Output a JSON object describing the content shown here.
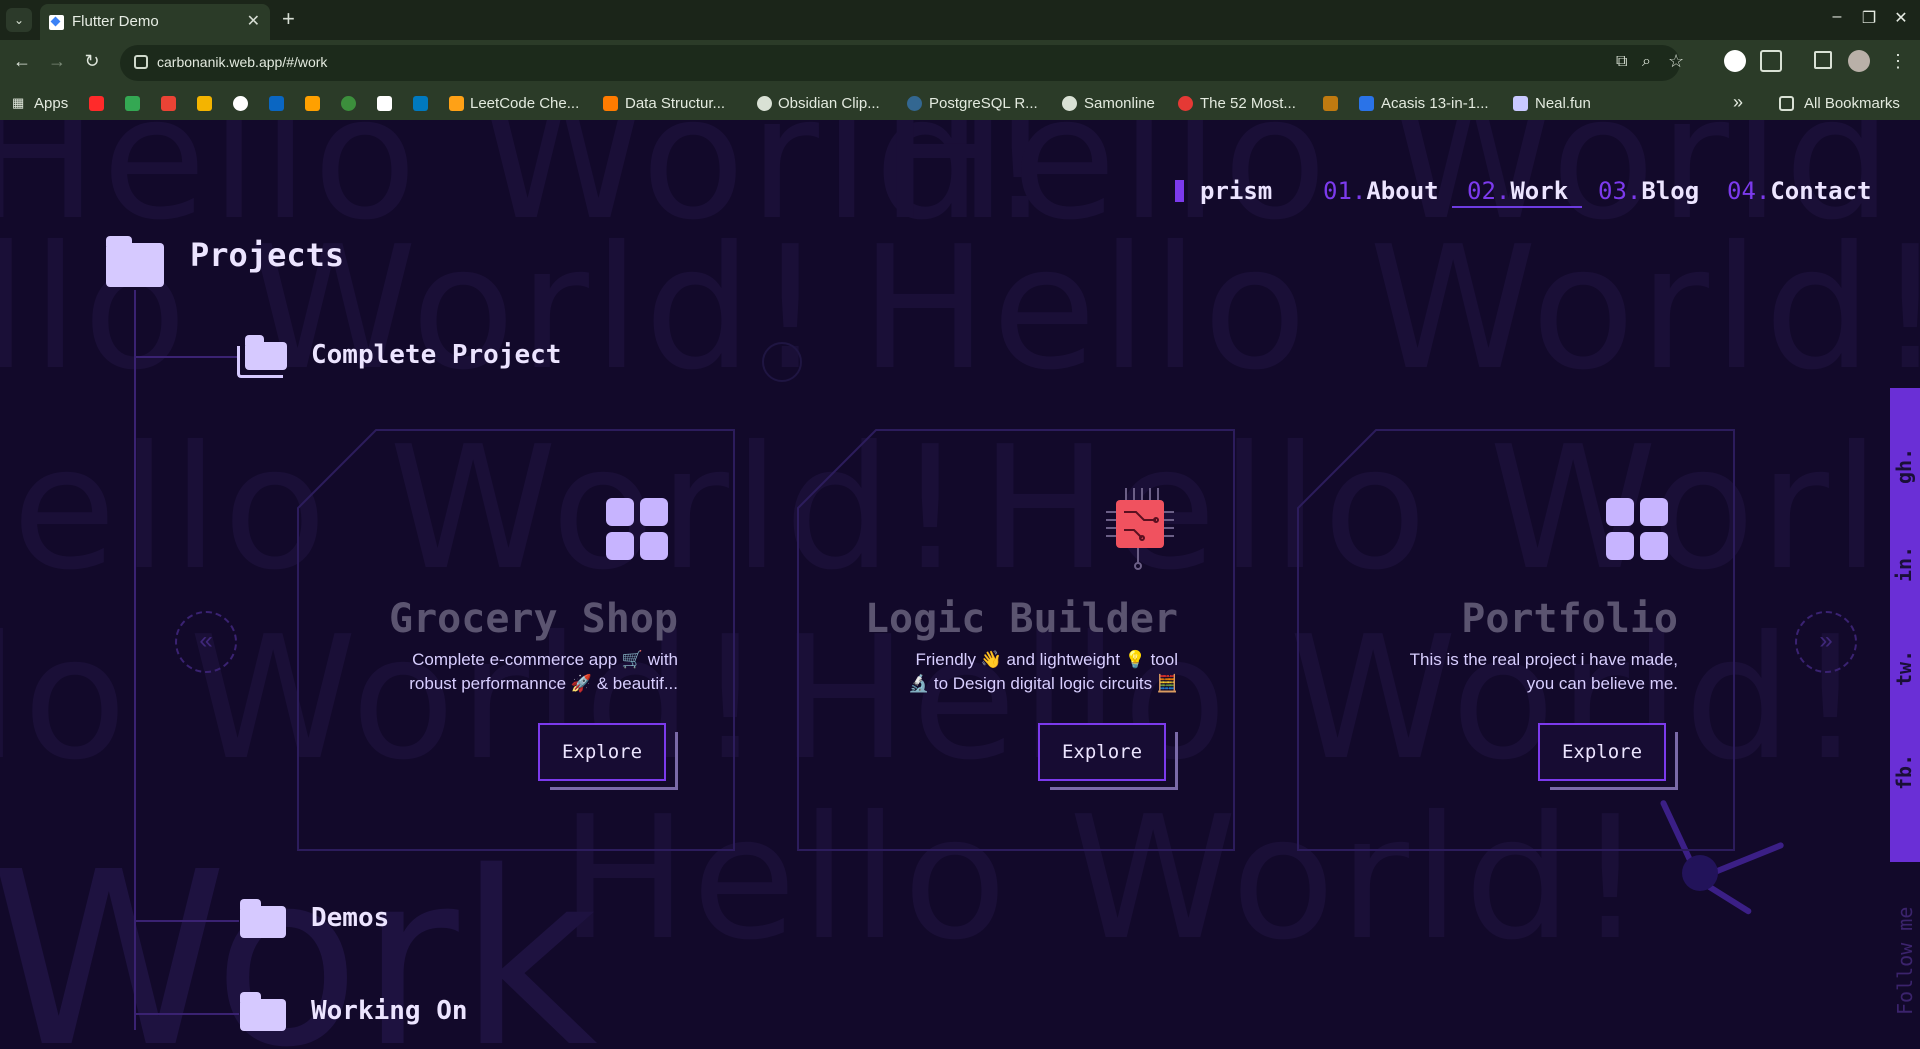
{
  "browser": {
    "tab_title": "Flutter Demo",
    "tab_close": "✕",
    "new_tab": "+",
    "url": "carbonanik.web.app/#/work",
    "window_controls": {
      "minimize": "–",
      "maximize": "❐",
      "close": "✕"
    },
    "nav": {
      "back": "←",
      "forward": "→",
      "reload": "↻"
    },
    "bookmarks": [
      "Apps",
      "LeetCode Che...",
      "Data Structur...",
      "Obsidian Clip...",
      "PostgreSQL R...",
      "Samonline",
      "The 52 Most...",
      "Acasis 13-in-1...",
      "Neal.fun"
    ],
    "more_bookmarks": "»",
    "all_bookmarks": "All Bookmarks"
  },
  "background": {
    "watermark": "Hello World!",
    "big_word": "Work"
  },
  "nav": {
    "brand": "prism",
    "items": [
      {
        "num": "01.",
        "label": "About"
      },
      {
        "num": "02.",
        "label": "Work"
      },
      {
        "num": "03.",
        "label": "Blog"
      },
      {
        "num": "04.",
        "label": "Contact"
      }
    ],
    "active": "Work"
  },
  "tree": {
    "root": "Projects",
    "complete": "Complete Project",
    "demos": "Demos",
    "working_on": "Working On"
  },
  "carousel": {
    "prev": "«",
    "next": "»",
    "cards": [
      {
        "title": "Grocery Shop",
        "desc1": "Complete e-commerce app 🛒 with",
        "desc2": "robust performannce 🚀 & beautif...",
        "icon": "grid-icon",
        "button": "Explore"
      },
      {
        "title": "Logic Builder",
        "desc1": "Friendly 👋 and lightweight 💡 tool",
        "desc2": "🔬 to Design digital logic circuits 🧮",
        "icon": "chip-icon",
        "button": "Explore"
      },
      {
        "title": "Portfolio",
        "desc1": "This is the real project i have made,",
        "desc2": "you can believe me.",
        "icon": "grid-icon",
        "button": "Explore"
      }
    ]
  },
  "social": {
    "links": [
      "gh.",
      "in.",
      "tw.",
      "fb."
    ],
    "follow": "Follow me"
  },
  "colors": {
    "background": "#12092a",
    "accent": "#7c3aed",
    "text": "#ece4ff",
    "icon": "#c7b4ff",
    "chip": "#f0525f"
  }
}
